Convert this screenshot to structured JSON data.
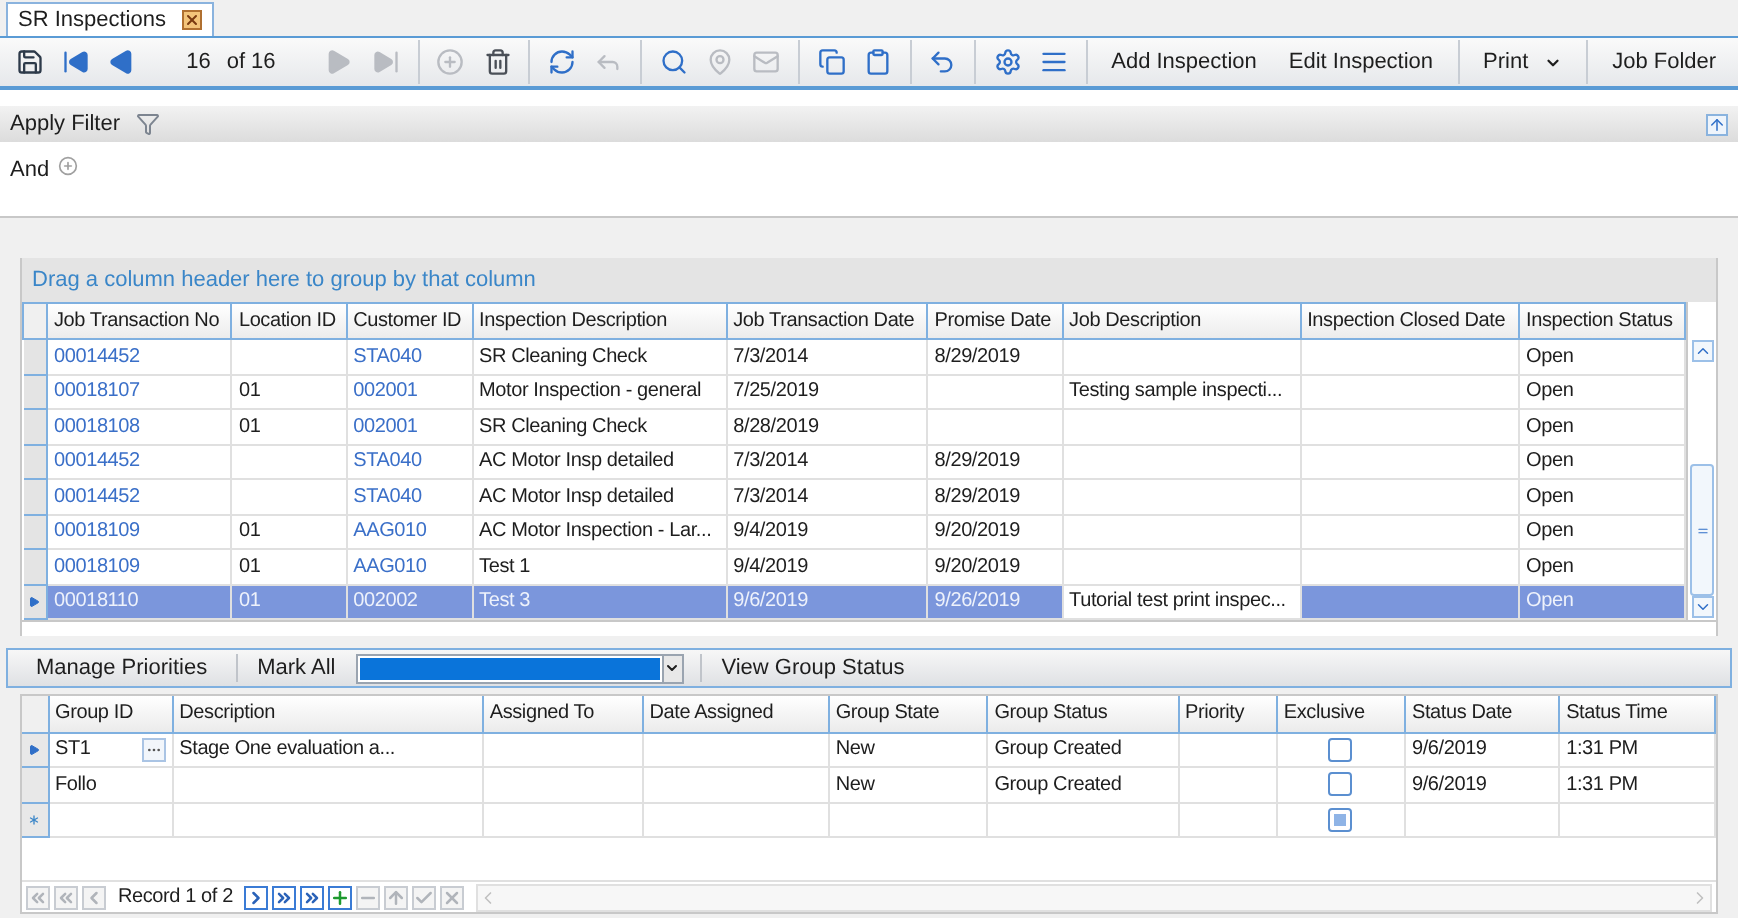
{
  "tab": {
    "title": "SR Inspections",
    "selected": true
  },
  "toolbar": {
    "items": [
      {
        "kind": "save",
        "disabled": false
      },
      {
        "kind": "first",
        "disabled": false
      },
      {
        "kind": "prev",
        "disabled": false
      },
      {
        "kind": "position",
        "text": "16"
      },
      {
        "kind": "count",
        "text": "of 16"
      },
      {
        "kind": "next",
        "disabled": true
      },
      {
        "kind": "last",
        "disabled": true
      },
      {
        "kind": "sep"
      },
      {
        "kind": "add",
        "disabled": true
      },
      {
        "kind": "delete",
        "disabled": false
      },
      {
        "kind": "sep"
      },
      {
        "kind": "refresh",
        "disabled": false
      },
      {
        "kind": "reply",
        "disabled": true
      },
      {
        "kind": "sep"
      },
      {
        "kind": "find",
        "disabled": false
      },
      {
        "kind": "pin",
        "disabled": true
      },
      {
        "kind": "mail",
        "disabled": true
      },
      {
        "kind": "sep"
      },
      {
        "kind": "copy",
        "disabled": false
      },
      {
        "kind": "paste",
        "disabled": false
      },
      {
        "kind": "sep"
      },
      {
        "kind": "undo",
        "disabled": false
      },
      {
        "kind": "sep"
      },
      {
        "kind": "settings",
        "disabled": false
      },
      {
        "kind": "list",
        "disabled": false
      },
      {
        "kind": "sep"
      },
      {
        "kind": "button",
        "text": "Add Inspection"
      },
      {
        "kind": "button",
        "text": "Edit Inspection"
      },
      {
        "kind": "sep"
      },
      {
        "kind": "dropdown",
        "text": "Print"
      },
      {
        "kind": "sep"
      },
      {
        "kind": "button",
        "text": "Job Folder"
      }
    ]
  },
  "filter": {
    "apply_label": "Apply Filter",
    "condition": "And"
  },
  "group_panel": {
    "hint": "Drag a column header here to group by that column"
  },
  "inspections": {
    "columns": [
      "Job Transaction No",
      "Location ID",
      "Customer ID",
      "Inspection Description",
      "Job Transaction Date",
      "Promise Date",
      "Job Description",
      "Inspection Closed Date",
      "Inspection Status"
    ],
    "rows": [
      {
        "selected": false,
        "cells": [
          "00014452",
          "",
          "STA040",
          "SR Cleaning Check",
          "7/3/2014",
          "8/29/2019",
          "",
          "",
          "Open"
        ]
      },
      {
        "selected": false,
        "cells": [
          "00018107",
          "01",
          "002001",
          "Motor Inspection - general",
          "7/25/2019",
          "",
          "Testing sample inspecti...",
          "",
          "Open"
        ]
      },
      {
        "selected": false,
        "cells": [
          "00018108",
          "01",
          "002001",
          "SR Cleaning Check",
          "8/28/2019",
          "",
          "",
          "",
          "Open"
        ]
      },
      {
        "selected": false,
        "cells": [
          "00014452",
          "",
          "STA040",
          "AC Motor Insp detailed",
          "7/3/2014",
          "8/29/2019",
          "",
          "",
          "Open"
        ]
      },
      {
        "selected": false,
        "cells": [
          "00014452",
          "",
          "STA040",
          "AC Motor Insp detailed",
          "7/3/2014",
          "8/29/2019",
          "",
          "",
          "Open"
        ]
      },
      {
        "selected": false,
        "cells": [
          "00018109",
          "01",
          "AAG010",
          "AC Motor Inspection - Lar...",
          "9/4/2019",
          "9/20/2019",
          "",
          "",
          "Open"
        ]
      },
      {
        "selected": false,
        "cells": [
          "00018109",
          "01",
          "AAG010",
          "Test 1",
          "9/4/2019",
          "9/20/2019",
          "",
          "",
          "Open"
        ]
      },
      {
        "selected": true,
        "cells": [
          "00018110",
          "01",
          "002002",
          "Test 3",
          "9/6/2019",
          "9/26/2019",
          "Tutorial test print inspec...",
          "",
          "Open"
        ]
      }
    ]
  },
  "group_toolbar": {
    "manage_label": "Manage Priorities",
    "mark_all_label": "Mark All",
    "view_label": "View Group Status"
  },
  "groups": {
    "columns": [
      "Group ID",
      "Description",
      "Assigned To",
      "Date Assigned",
      "Group State",
      "Group Status",
      "Priority",
      "Exclusive",
      "Status Date",
      "Status Time"
    ],
    "rows": [
      {
        "kind": "record",
        "current": true,
        "checked": false,
        "indeterminate": false,
        "cells": [
          "ST1",
          "Stage One evaluation a...",
          "",
          "",
          "New",
          "Group Created",
          "",
          "",
          "9/6/2019",
          "1:31 PM"
        ]
      },
      {
        "kind": "record",
        "current": false,
        "checked": false,
        "indeterminate": false,
        "cells": [
          "Follo",
          "",
          "",
          "",
          "New",
          "Group Created",
          "",
          "",
          "9/6/2019",
          "1:31 PM"
        ]
      },
      {
        "kind": "new",
        "current": false,
        "indeterminate": true
      }
    ]
  },
  "navigator": {
    "text": "Record 1 of 2",
    "buttons": [
      {
        "kind": "first",
        "disabled": true
      },
      {
        "kind": "prev-page",
        "disabled": true
      },
      {
        "kind": "prev",
        "disabled": true
      },
      {
        "kind": "label"
      },
      {
        "kind": "next",
        "disabled": false
      },
      {
        "kind": "next-page",
        "disabled": false
      },
      {
        "kind": "last",
        "disabled": false
      },
      {
        "kind": "append",
        "disabled": false
      },
      {
        "kind": "remove",
        "disabled": true
      },
      {
        "kind": "edit",
        "disabled": true
      },
      {
        "kind": "end-edit",
        "disabled": true
      },
      {
        "kind": "cancel",
        "disabled": true
      }
    ]
  }
}
